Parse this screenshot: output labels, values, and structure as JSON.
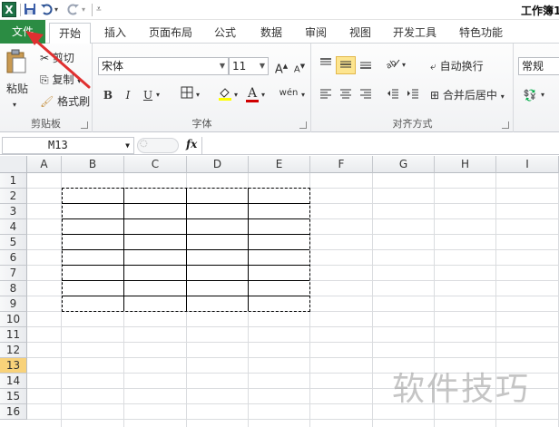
{
  "app": {
    "logo_letter": "X",
    "title": "工作簿1",
    "accent": "#2b8c43"
  },
  "quick_access": {
    "save_icon": "save-icon",
    "undo_icon": "undo-icon",
    "redo_icon": "redo-icon",
    "customize_icon": "customize-icon"
  },
  "tabs": [
    {
      "label": "文件"
    },
    {
      "label": "开始"
    },
    {
      "label": "插入"
    },
    {
      "label": "页面布局"
    },
    {
      "label": "公式"
    },
    {
      "label": "数据"
    },
    {
      "label": "审阅"
    },
    {
      "label": "视图"
    },
    {
      "label": "开发工具"
    },
    {
      "label": "特色功能"
    }
  ],
  "ribbon": {
    "clipboard": {
      "label": "剪贴板",
      "paste": "粘贴",
      "cut": "剪切",
      "copy": "复制",
      "format_painter": "格式刷"
    },
    "font": {
      "label": "字体",
      "font_name": "宋体",
      "font_size": "11",
      "bold": "B",
      "italic": "I",
      "underline": "U",
      "grow": "A",
      "shrink": "A",
      "color_letter": "A",
      "font_color": "#d00000",
      "fill_color": "#ffff00"
    },
    "alignment": {
      "label": "对齐方式",
      "wrap_text": "自动换行",
      "merge_center": "合并后居中"
    },
    "number": {
      "format": "常规"
    }
  },
  "formula_bar": {
    "name_box": "M13",
    "fx": "fx",
    "value": ""
  },
  "grid": {
    "columns": [
      "A",
      "B",
      "C",
      "D",
      "E",
      "F",
      "G",
      "H",
      "I"
    ],
    "rows": [
      "1",
      "2",
      "3",
      "4",
      "5",
      "6",
      "7",
      "8",
      "9",
      "10",
      "11",
      "12",
      "13",
      "14",
      "15",
      "16"
    ],
    "selected_row": "13"
  },
  "watermark": "软件技巧"
}
